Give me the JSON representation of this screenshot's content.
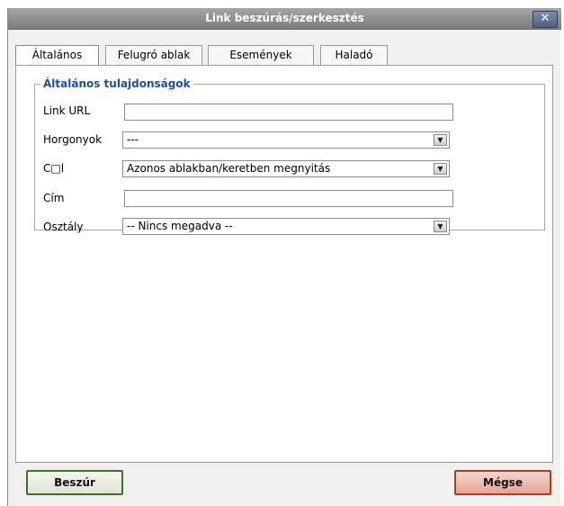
{
  "dialog": {
    "title": "Link beszúrás/szerkesztés",
    "close_symbol": "✕"
  },
  "tabs": [
    {
      "label": "Általános",
      "active": true
    },
    {
      "label": "Felugró ablak",
      "active": false
    },
    {
      "label": "Események",
      "active": false
    },
    {
      "label": "Haladó",
      "active": false
    }
  ],
  "general": {
    "legend": "Általános tulajdonságok",
    "fields": {
      "link_url": {
        "label": "Link URL",
        "value": ""
      },
      "anchors": {
        "label": "Horgonyok",
        "value": "---"
      },
      "target": {
        "label": "C□l",
        "value": "Azonos ablakban/keretben megnyitás"
      },
      "title": {
        "label": "Cím",
        "value": ""
      },
      "class": {
        "label": "Osztály",
        "value": "-- Nincs megadva --"
      }
    }
  },
  "buttons": {
    "insert": "Beszúr",
    "cancel": "Mégse"
  },
  "colors": {
    "legend": "#1f4fa0",
    "insert_border": "#3f6e2d",
    "cancel_border": "#b23a22"
  }
}
